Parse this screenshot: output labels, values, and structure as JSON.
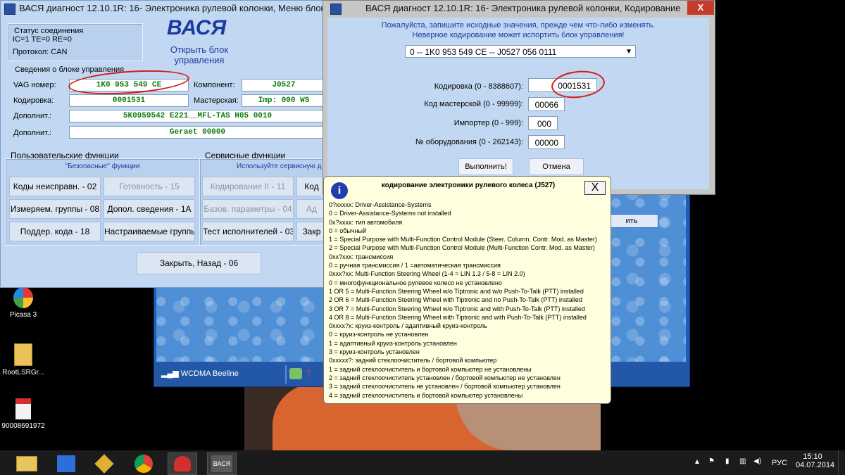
{
  "colors": {
    "accent": "#1a3aa0",
    "field_text": "#117a11",
    "annotation": "#d71919",
    "close_btn": "#c73b2b"
  },
  "win1": {
    "title": "ВАСЯ диагност 12.10.1R: 16- Электроника рулевой колонки,  Меню блока",
    "status": {
      "heading": "Статус соединения",
      "line1": "IC=1  TE=0   RE=0",
      "protocol": "Протокол: CAN"
    },
    "logo": "ВАСЯ",
    "logo_sub": "Открыть блок управления",
    "info_heading": "Сведения о блоке управления",
    "labels": {
      "vag": "VAG номер:",
      "coding": "Кодировка:",
      "extra1": "Дополнит.:",
      "extra2": "Дополнит.:",
      "component": "Компонент:",
      "workshop": "Мастерская:"
    },
    "values": {
      "vag": "1K0 953 549 CE",
      "coding": "0001531",
      "extra1": "5K0959542  E221__MFL-TAS   H05 0010",
      "extra2": "Geraet 00000",
      "component": "J0527",
      "workshop": "Imp: 000    WS"
    },
    "user_funcs": {
      "heading": "Пользовательские функции",
      "sub": "\"Безопасные\" функции",
      "buttons": [
        "Коды неисправн. - 02",
        "Готовность - 15",
        "Измеряем. группы - 08",
        "Допол. сведения - 1А",
        "Поддер. кода - 18",
        "Настраиваемые группы"
      ]
    },
    "service_funcs": {
      "heading": "Сервисные функции",
      "sub": "Используйте сервисную д",
      "buttons": [
        "Кодирование II - 11",
        "Код",
        "Базов. параметры - 04",
        "Ад",
        "Тест исполнителей - 03",
        "Закр"
      ]
    },
    "close_button": "Закрыть, Назад - 06"
  },
  "win2": {
    "title": "ВАСЯ диагност 12.10.1R: 16- Электроника рулевой колонки,  Кодирование",
    "warn1": "Пожалуйста, запишите исходные значения, прежде чем что-либо изменять.",
    "warn2": "Неверное кодирование может испортить блок управления!",
    "combo": "0 -- 1K0 953 549 CE -- J0527          056 0111",
    "rows": [
      {
        "label": "Кодировка (0 - 8388607):",
        "value": "0001531"
      },
      {
        "label": "Код мастерской (0 - 99999):",
        "value": "00066"
      },
      {
        "label": "Импортер (0 - 999):",
        "value": "000"
      },
      {
        "label": "№ оборудования (0 - 262143):",
        "value": "00000"
      }
    ],
    "execute": "Выполнить!",
    "cancel": "Отмена",
    "close_glyph": "X"
  },
  "popup": {
    "info_glyph": "i",
    "title": "кодирование электроники рулевого колеса (J527)",
    "close_glyph": "X",
    "lines": [
      "0?xxxxx: Driver-Assistance-Systems",
      "0 = Driver-Assistance-Systems not installed",
      "0x?xxxx: тип автомобиля",
      "0 = обычный",
      "1 = Special Purpose with Multi-Function Control Module (Steer. Column. Contr. Mod. as Master)",
      "2 = Special Purpose with Multi-Function Control Module (Multi-Function Contr. Mod. as Master)",
      "0xx?xxx: трансмиссия",
      "0 = ручная трансмиссия / 1 =автоматическая трансмиссия",
      "0xxx?xx: Multi-Function Steering Wheel (1-4 = LIN 1.3 / 5-8 = LIN 2.0)",
      "0 = многофункциональное рулевое колесо не установлено",
      "1 OR 5 = Multi-Function Steering Wheel w/o Tiptronic and w/o Push-To-Talk (PTT) installed",
      "2 OR 6 = Multi-Function Steering Wheel with Tiptronic and no Push-To-Talk (PTT) installed",
      "3 OR 7 = Multi-Function Steering Wheel w/o Tiptronic and with Push-To-Talk (PTT) installed",
      "4 OR 8 = Multi-Function Steering Wheel with Tiptronic and with Push-To-Talk (PTT) installed",
      "0xxxx?x: круиз-контроль / адаптивный круиз-контроль",
      "0 = круиз-контроль не установлен",
      "1 = адаптивный круиз-контроль установлен",
      "3 = круиз-контроль установлен",
      "0xxxxx?: задний стеклоочиститель / бортовой компьютер",
      "1 = задний стеклоочиститель и бортовой компьютер не установлены",
      "2 = задний стеклоочиститель установлен / бортовой компьютер не установлен",
      "3 = задний стеклоочиститель не установлен / бортовой компьютер установлен",
      "4 = задний стеклоочиститель и бортовой компьютер установлены"
    ]
  },
  "bgapp": {
    "network": "WCDMA  Beeline",
    "button_fragment": "ить"
  },
  "desktop": {
    "icons": [
      {
        "name": "picasa",
        "label": "Picasa 3"
      },
      {
        "name": "folder",
        "label": "RootLSRGr..."
      },
      {
        "name": "pdf",
        "label": "90008691972"
      }
    ]
  },
  "taskbar": {
    "lang": "РУС",
    "time": "15:10",
    "date": "04.07.2014",
    "vasya_label": "ВАСЯ"
  }
}
